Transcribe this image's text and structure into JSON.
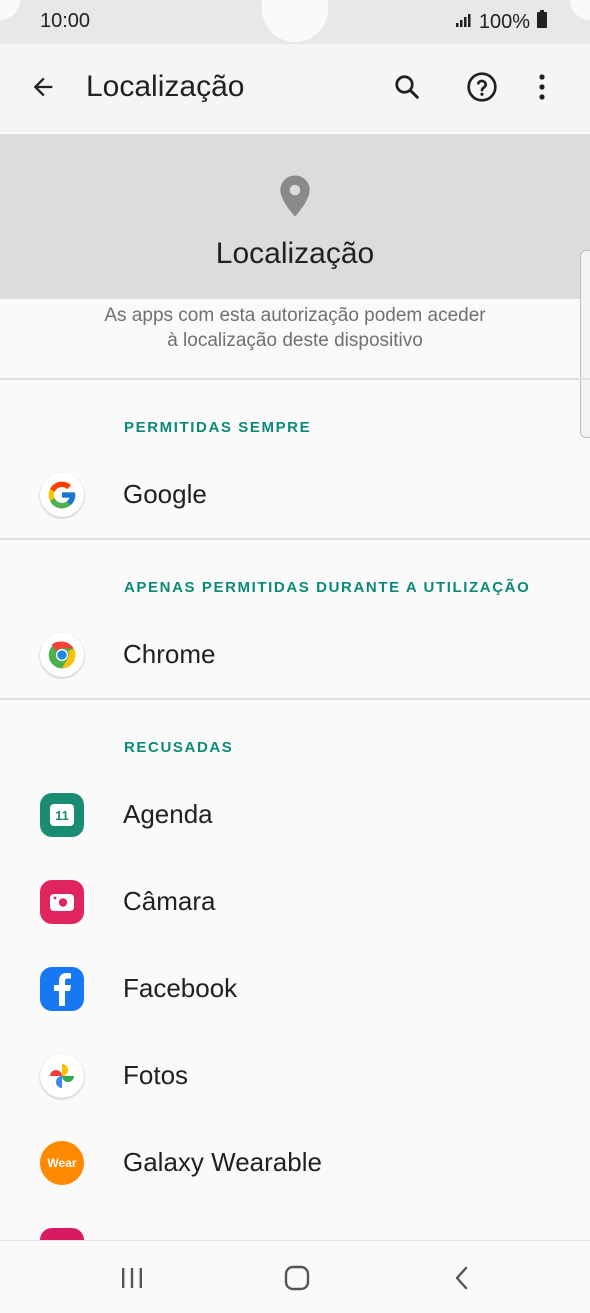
{
  "status": {
    "time": "10:00",
    "battery": "100%"
  },
  "header": {
    "title": "Localização"
  },
  "hero": {
    "title": "Localização",
    "description_line1": "As apps com esta autorização podem aceder",
    "description_line2": "à localização deste dispositivo"
  },
  "sections": {
    "always": "PERMITIDAS SEMPRE",
    "while_using": "APENAS PERMITIDAS DURANTE A UTILIZAÇÃO",
    "denied": "RECUSADAS"
  },
  "apps": {
    "google": "Google",
    "chrome": "Chrome",
    "agenda": "Agenda",
    "agenda_icon_text": "11",
    "camara": "Câmara",
    "facebook": "Facebook",
    "fotos": "Fotos",
    "galaxy_wearable": "Galaxy Wearable",
    "wear_icon_text": "Wear"
  },
  "icons": {
    "back": "back-arrow-icon",
    "search": "search-icon",
    "help": "help-icon",
    "more": "more-vertical-icon",
    "location": "location-pin-icon",
    "nav_recents": "recents-icon",
    "nav_home": "home-icon",
    "nav_back": "nav-back-icon"
  },
  "colors": {
    "section_accent": "#0b8a7a",
    "agenda": "#1a8c74",
    "camara": "#e0245e",
    "facebook": "#1877f2",
    "wear": "#ff8a00"
  }
}
